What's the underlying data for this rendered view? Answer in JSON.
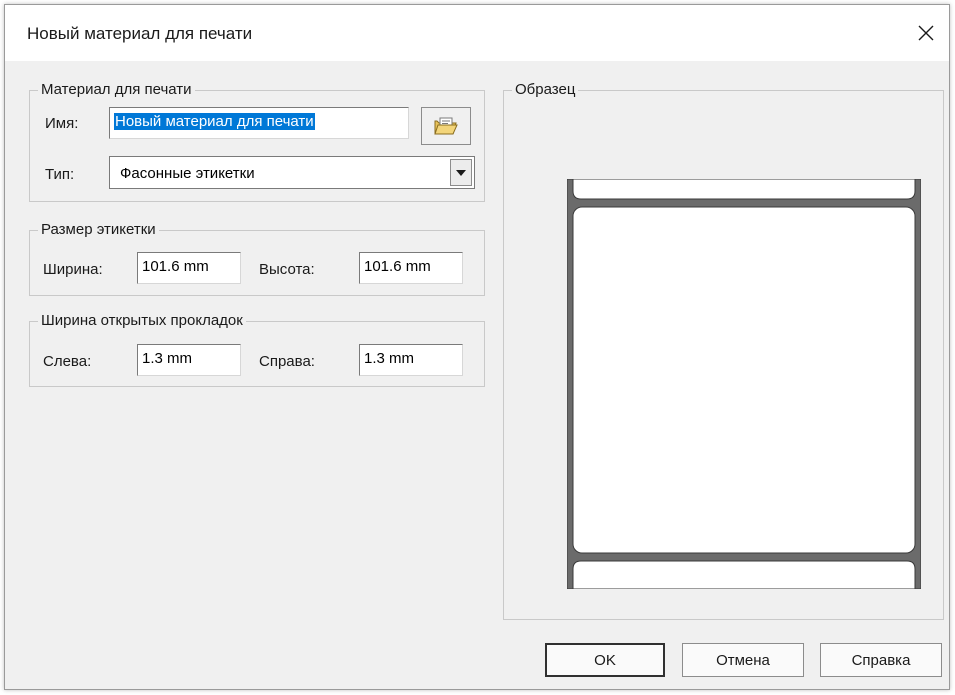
{
  "window": {
    "title": "Новый материал для печати",
    "close_icon": "close-icon"
  },
  "material_group": {
    "legend": "Материал для печати",
    "name_label": "Имя:",
    "name_value": "Новый материал для печати",
    "type_label": "Тип:",
    "type_value": "Фасонные этикетки",
    "browse_icon": "folder-icon",
    "dropdown_icon": "chevron-down-icon"
  },
  "size_group": {
    "legend": "Размер этикетки",
    "width_label": "Ширина:",
    "width_value": "101.6 mm",
    "height_label": "Высота:",
    "height_value": "101.6 mm"
  },
  "liner_group": {
    "legend": "Ширина открытых прокладок",
    "left_label": "Слева:",
    "left_value": "1.3 mm",
    "right_label": "Справа:",
    "right_value": "1.3 mm"
  },
  "preview_group": {
    "legend": "Образец"
  },
  "buttons": {
    "ok": "OK",
    "cancel": "Отмена",
    "help": "Справка"
  },
  "colors": {
    "selection": "#0078d7",
    "liner": "#6b6b6b",
    "dialog_bg": "#f0f0f0"
  }
}
